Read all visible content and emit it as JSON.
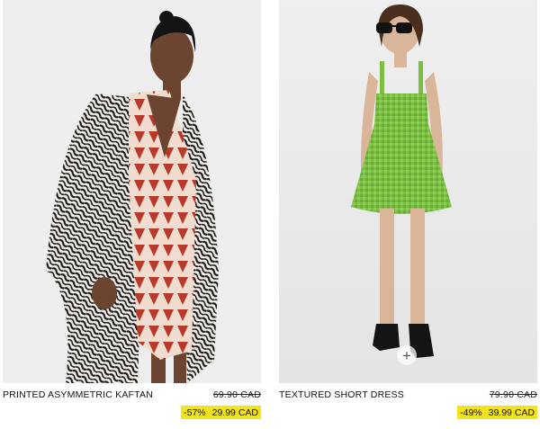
{
  "products": [
    {
      "name": "PRINTED ASYMMETRIC KAFTAN",
      "old_price": "69.90 CAD",
      "discount": "-57%",
      "price": "29.99 CAD"
    },
    {
      "name": "TEXTURED SHORT DRESS",
      "old_price": "79.90 CAD",
      "discount": "-49%",
      "price": "39.99 CAD",
      "add_button": "+"
    }
  ],
  "colors": {
    "sale_highlight": "#f3e31a",
    "background": "#ffffff"
  }
}
